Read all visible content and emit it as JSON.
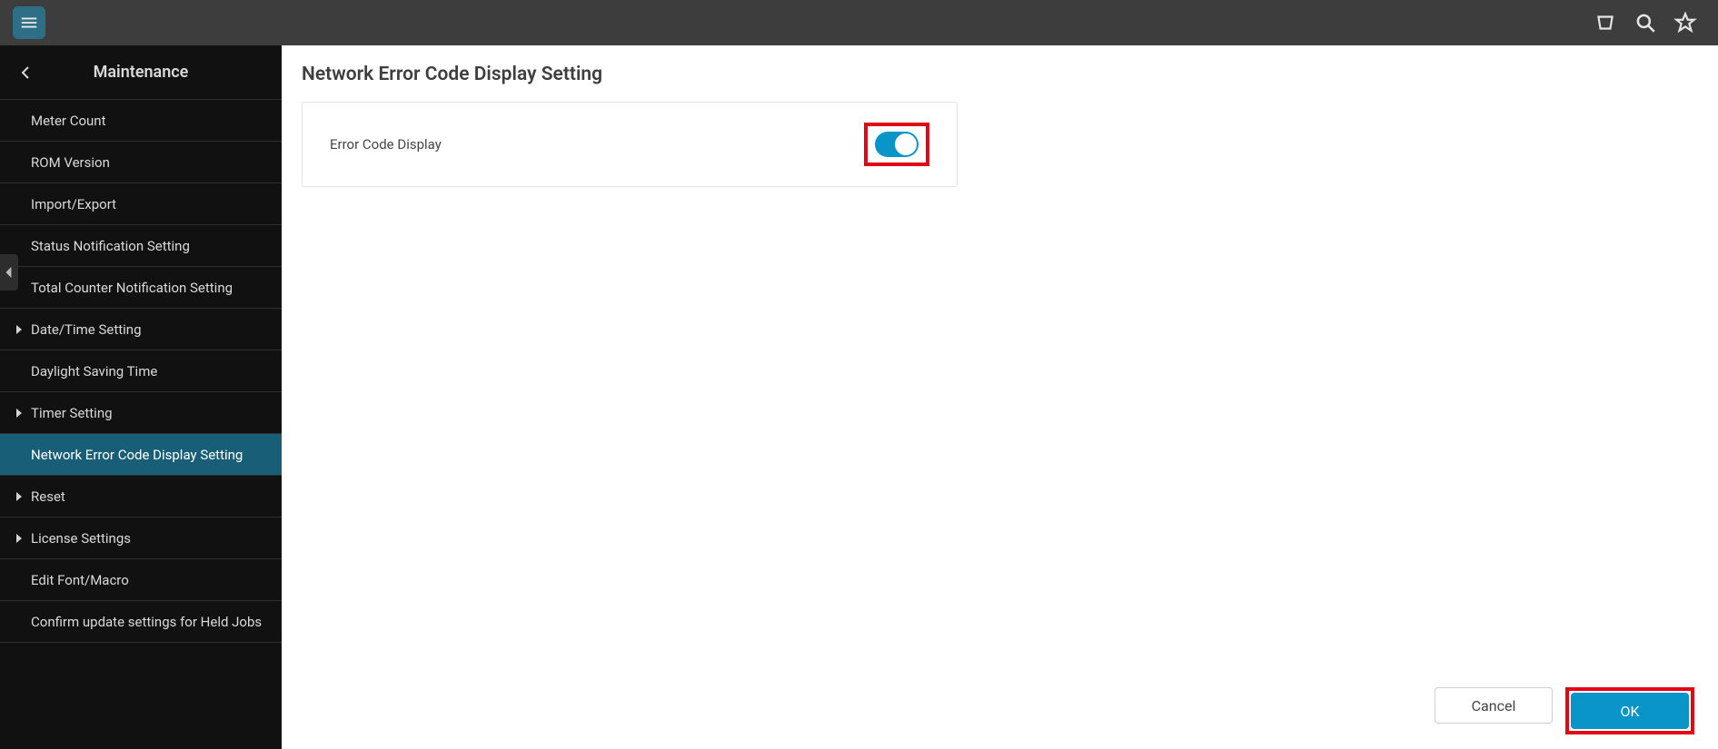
{
  "sidebar": {
    "title": "Maintenance",
    "items": [
      {
        "label": "Meter Count",
        "expandable": false,
        "selected": false
      },
      {
        "label": "ROM Version",
        "expandable": false,
        "selected": false
      },
      {
        "label": "Import/Export",
        "expandable": false,
        "selected": false
      },
      {
        "label": "Status Notification Setting",
        "expandable": false,
        "selected": false
      },
      {
        "label": "Total Counter Notification Setting",
        "expandable": false,
        "selected": false
      },
      {
        "label": "Date/Time Setting",
        "expandable": true,
        "selected": false
      },
      {
        "label": "Daylight Saving Time",
        "expandable": false,
        "selected": false
      },
      {
        "label": "Timer Setting",
        "expandable": true,
        "selected": false
      },
      {
        "label": "Network Error Code Display Setting",
        "expandable": false,
        "selected": true
      },
      {
        "label": "Reset",
        "expandable": true,
        "selected": false
      },
      {
        "label": "License Settings",
        "expandable": true,
        "selected": false
      },
      {
        "label": "Edit Font/Macro",
        "expandable": false,
        "selected": false
      },
      {
        "label": "Confirm update settings for Held Jobs",
        "expandable": false,
        "selected": false
      }
    ]
  },
  "page": {
    "title": "Network Error Code Display Setting",
    "row_label": "Error Code Display",
    "toggle_on": true
  },
  "footer": {
    "cancel": "Cancel",
    "ok": "OK"
  }
}
